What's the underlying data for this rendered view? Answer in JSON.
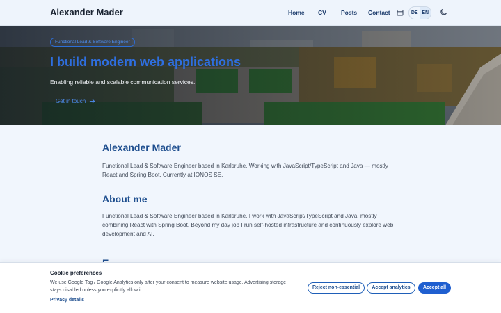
{
  "header": {
    "brand": "Alexander Mader",
    "nav": {
      "home": "Home",
      "cv": "CV",
      "posts": "Posts",
      "contact": "Contact"
    },
    "icons": {
      "calendar": "calendar-icon",
      "theme": "moon-icon"
    },
    "languages": [
      "DE",
      "EN"
    ],
    "active_language": "EN"
  },
  "hero": {
    "badge": "Functional Lead & Software Engineer",
    "title": "I build modern web applications",
    "subtitle": "Enabling reliable and scalable communication services.",
    "cta": "Get in touch"
  },
  "main": {
    "name_heading": "Alexander Mader",
    "intro": "Functional Lead & Software Engineer based in Karlsruhe. Working with JavaScript/TypeScript and Java — mostly React and Spring Boot. Currently at IONOS SE.",
    "about_heading": "About me",
    "about_text": "Functional Lead & Software Engineer based in Karlsruhe. I work with JavaScript/TypeScript and Java, mostly combining React with Spring Boot. Beyond my day job I run self-hosted infrastructure and continuously explore web development and AI.",
    "partial_heading": "E"
  },
  "cookie": {
    "title": "Cookie preferences",
    "text": "We use Google Tag / Google Analytics only after your consent to measure website usage. Advertising storage stays disabled unless you explicitly allow it.",
    "privacy_link": "Privacy details",
    "buttons": {
      "reject": "Reject non-essential",
      "analytics": "Accept analytics",
      "accept": "Accept all"
    }
  },
  "colors": {
    "accent": "#1f5fd0",
    "heading": "#1f4f8f",
    "background": "#f1f6fd"
  }
}
